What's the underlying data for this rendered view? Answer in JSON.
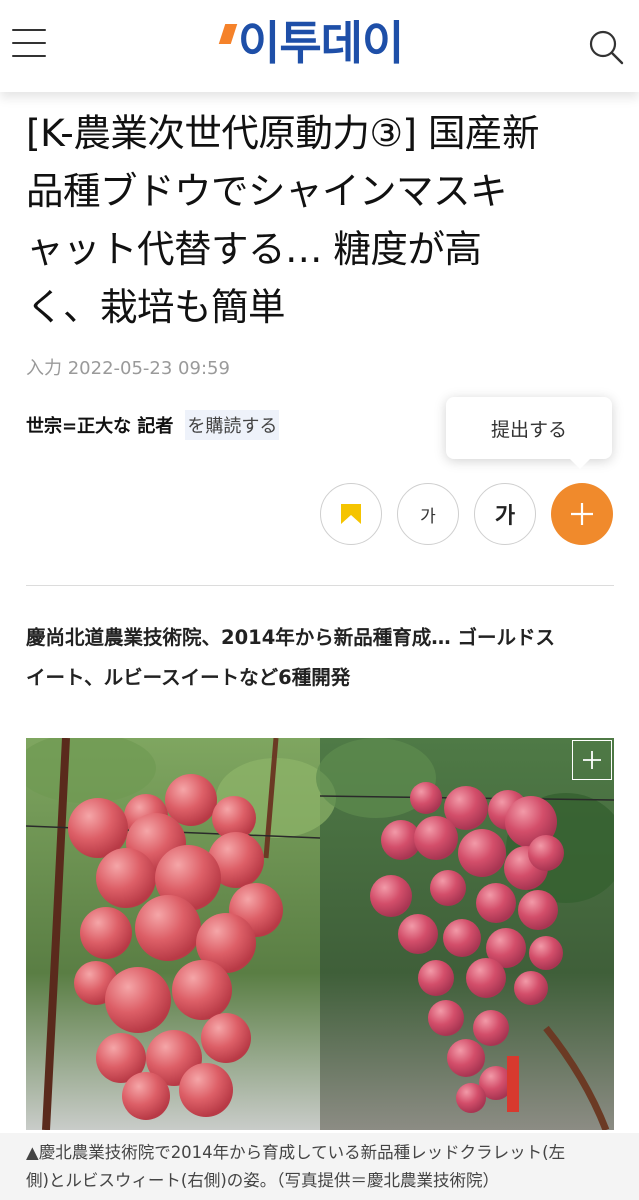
{
  "header": {
    "logo_text": "이투데이",
    "menu_icon": "hamburger-menu-icon",
    "search_icon": "search-icon",
    "brand_color": "#1e4fa8",
    "accent_color": "#f5822a"
  },
  "article": {
    "headline_lines": [
      "[K-農業次世代原動力③] 国産新",
      "品種ブドウでシャインマスキ",
      "ャット代替する… 糖度が高",
      "く、栽培も簡単"
    ],
    "input_date": "入力 2022-05-23 09:59",
    "reporter": "世宗=正大な 記者",
    "subscribe_label": "を購読する",
    "tooltip_label": "提出する",
    "font_small_label": "가",
    "font_large_label": "가",
    "bookmark_icon": "bookmark-icon",
    "plus_icon": "plus-icon",
    "plus_color": "#f08a2c",
    "subhead_lines": [
      "慶尚北道農業技術院、2014年から新品種育成… ゴールドス",
      "イート、ルビースイートなど6種開発"
    ],
    "photo_expand_icon": "expand-plus-icon",
    "caption_lines": [
      "▲慶北農業技術院で2014年から育成している新品種レッドクラレット(左",
      "側)とルビスウィート(右側)の姿。（写真提供＝慶北農業技術院）"
    ]
  }
}
